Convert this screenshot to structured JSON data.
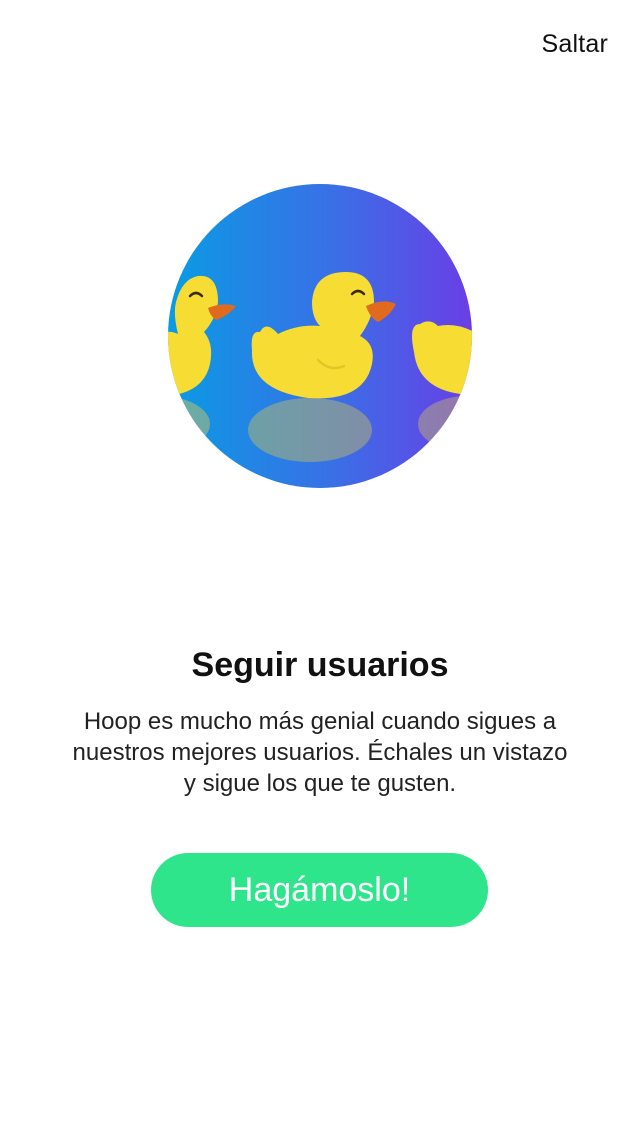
{
  "header": {
    "skip_label": "Saltar"
  },
  "hero": {
    "illustration_icon": "rubber-ducks-illustration",
    "gradient_start": "#0a9be4",
    "gradient_end": "#6a3ee6",
    "duck_color": "#f6dc33",
    "beak_color": "#e06b1e"
  },
  "content": {
    "title": "Seguir usuarios",
    "description": "Hoop es mucho más genial cuando sigues a nuestros mejores usuarios. Échales un vistazo y sigue los que te gusten."
  },
  "actions": {
    "primary_label": "Hagámoslo!",
    "primary_color": "#2ee58b"
  }
}
